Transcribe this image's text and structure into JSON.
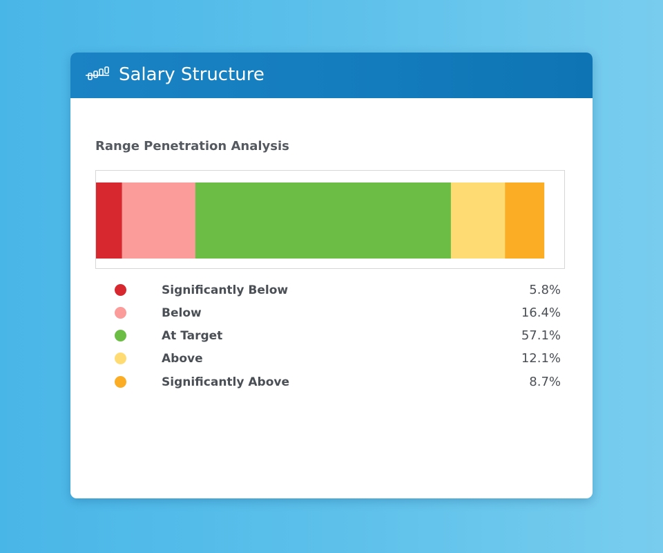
{
  "widget": {
    "title": "Salary Structure",
    "icon": "salary-structure-icon"
  },
  "chart_data": {
    "type": "bar",
    "orientation": "horizontal-stacked",
    "title": "Range Penetration Analysis",
    "unit": "%",
    "categories": [
      "Significantly Below",
      "Below",
      "At Target",
      "Above",
      "Significantly Above"
    ],
    "values": [
      5.8,
      16.4,
      57.1,
      12.1,
      8.7
    ],
    "value_labels": [
      "5.8%",
      "16.4%",
      "57.1%",
      "12.1%",
      "8.7%"
    ],
    "colors": [
      "#d7282f",
      "#fb9b9a",
      "#6cbd45",
      "#ffdc73",
      "#fcad26"
    ],
    "legend_position": "bottom",
    "grid": false
  }
}
